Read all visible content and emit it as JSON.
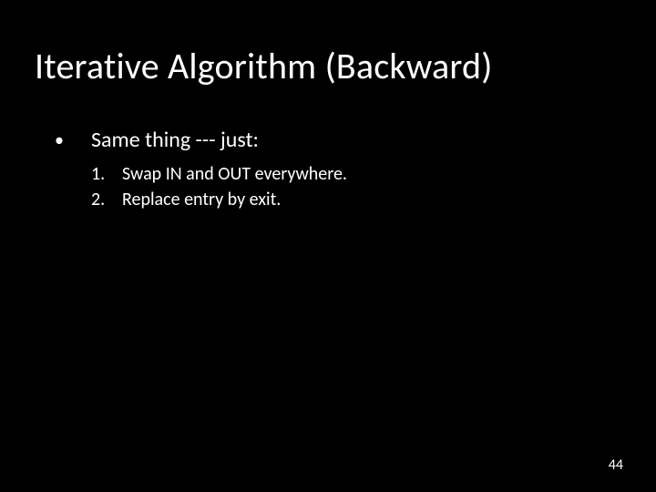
{
  "slide": {
    "title": "Iterative Algorithm (Backward)",
    "bullet": {
      "marker": "•",
      "text": "Same thing --- just:"
    },
    "numbered": [
      {
        "label": "1.",
        "text": "Swap IN and OUT everywhere."
      },
      {
        "label": "2.",
        "text": "Replace entry by exit."
      }
    ],
    "page_number": "44"
  }
}
